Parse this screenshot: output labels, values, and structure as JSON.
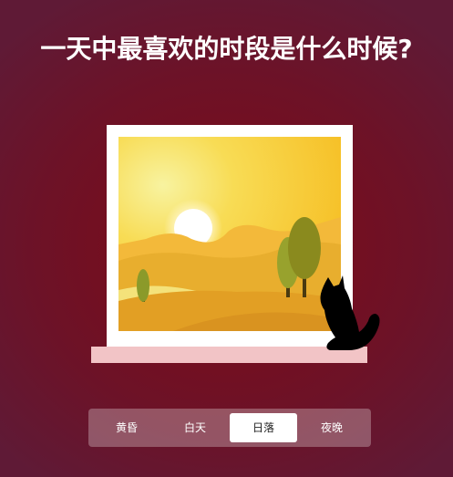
{
  "page": {
    "title": "一天中最喜欢的时段是什么时候?"
  },
  "tabs": [
    {
      "label": "黄昏",
      "active": false
    },
    {
      "label": "白天",
      "active": false
    },
    {
      "label": "日落",
      "active": true
    },
    {
      "label": "夜晚",
      "active": false
    }
  ],
  "colors": {
    "background": "#7e0a16",
    "sky": "#f7c825",
    "sun": "#ffffff",
    "hills": "#e6a727",
    "trees": "#8b9a2a",
    "sill": "#f2c4c6",
    "cat": "#000000"
  },
  "icons": {
    "cat": "cat-icon",
    "sun": "sun-icon",
    "tree": "tree-icon"
  }
}
